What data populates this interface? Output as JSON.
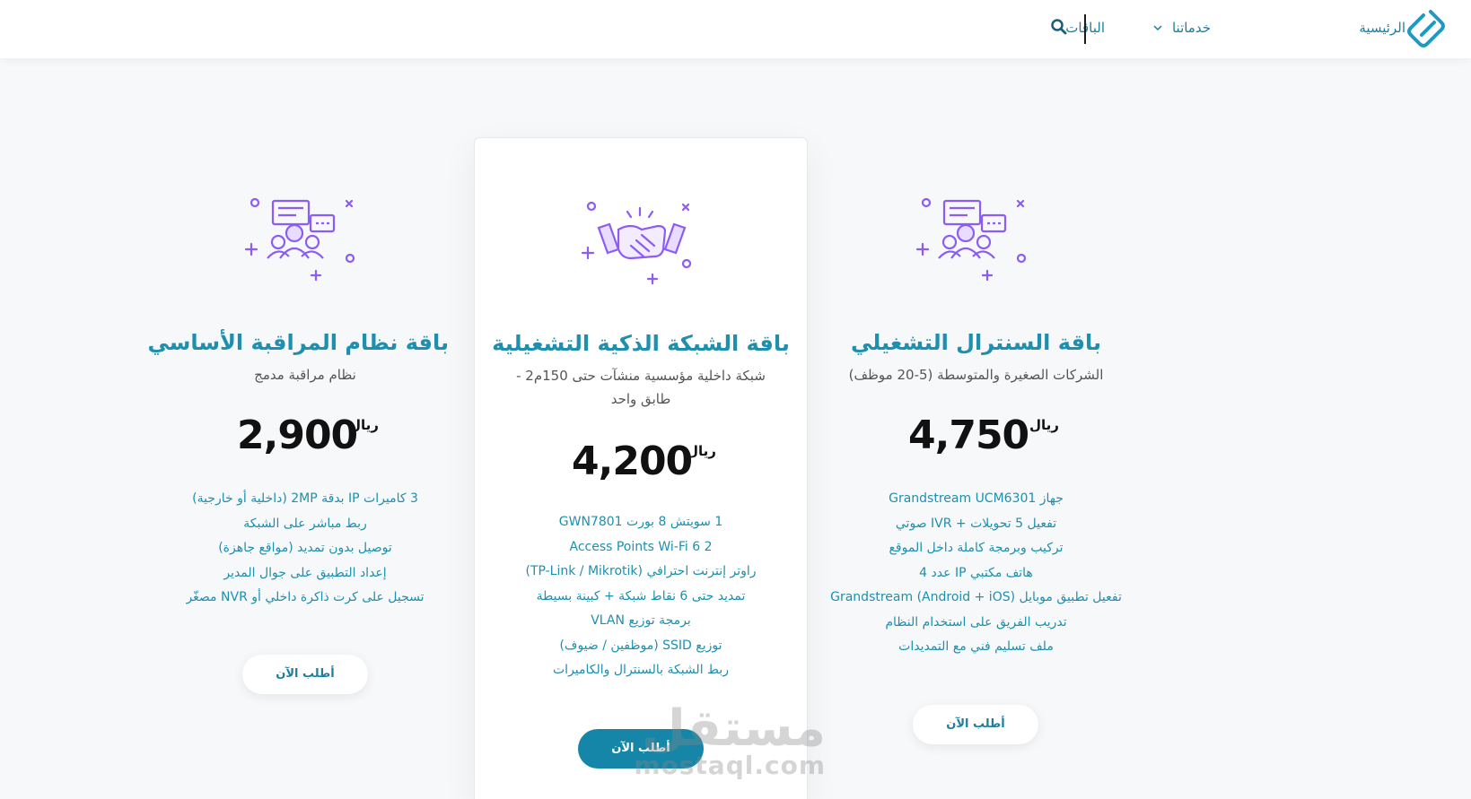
{
  "nav": {
    "home": "الرئيسية",
    "services": "خدماتنا",
    "packages": "الباقات"
  },
  "icons": {
    "logo": "brand-logo-icon",
    "search": "search-icon",
    "services_dropdown": "chevron-down-icon"
  },
  "colors": {
    "accent": "#1e8fae",
    "button": "#1686a8",
    "illustration": "#8b5cf6"
  },
  "packages": [
    {
      "title": "باقة السنترال التشغيلي",
      "subtitle": "الشركات الصغيرة والمتوسطة (5-20 موظف)",
      "price": "4,750",
      "currency": "ريال",
      "illustration": "people-chat-icon",
      "features": [
        "جهاز Grandstream UCM6301",
        "تفعيل 5 تحويلات + IVR صوتي",
        "تركيب وبرمجة كاملة داخل الموقع",
        "هاتف مكتبي IP عدد 4",
        "تفعيل تطبيق موبايل Grandstream (Android + iOS)",
        "تدريب الفريق على استخدام النظام",
        "ملف تسليم فني مع التمديدات"
      ],
      "button": "أطلب الآن"
    },
    {
      "title": "باقة الشبكة الذكية التشغيلية",
      "subtitle": "شبكة داخلية مؤسسية منشآت حتى 150م2 - طابق واحد",
      "price": "4,200",
      "currency": "ريال",
      "illustration": "handshake-icon",
      "features": [
        "1 سويتش 8 بورت GWN7801",
        "2 Access Points Wi-Fi 6",
        "راوتر إنترنت احترافي (TP-Link / Mikrotik)",
        "تمديد حتى 6 نقاط شبكة + كبينة بسيطة",
        "برمجة توزيع VLAN",
        "توزيع SSID (موظفين / ضيوف)",
        "ربط الشبكة بالسنترال والكاميرات"
      ],
      "button": "أطلب الآن"
    },
    {
      "title": "باقة نظام المراقبة الأساسي",
      "subtitle": "نظام مراقبة مدمج",
      "price": "2,900",
      "currency": "ريال",
      "illustration": "people-chat-icon",
      "features": [
        "3 كاميرات IP بدقة 2MP (داخلية أو خارجية)",
        "ربط مباشر على الشبكة",
        "توصيل بدون تمديد (مواقع جاهزة)",
        "إعداد التطبيق على جوال المدير",
        "تسجيل على كرت ذاكرة داخلي أو NVR مصغّر"
      ],
      "button": "أطلب الآن"
    }
  ],
  "watermark": {
    "arabic": "مستقل",
    "latin": "mostaql.com"
  }
}
